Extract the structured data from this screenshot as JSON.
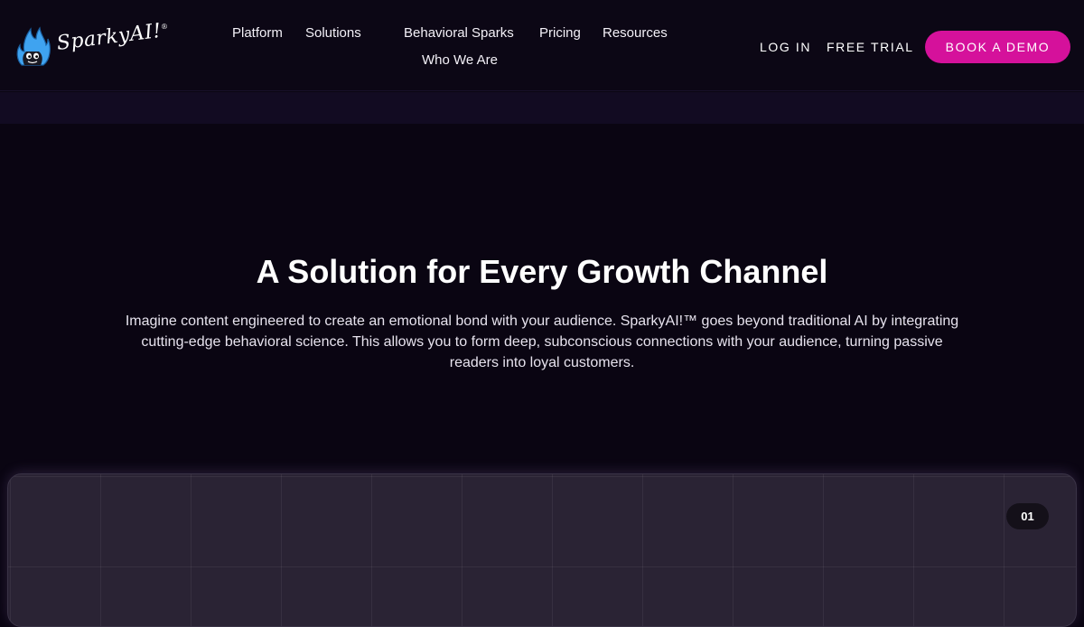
{
  "brand": {
    "name": "SparkyAI!",
    "trademark": "®",
    "logo_icon": "flame-face-icon",
    "colors": {
      "background": "#0a0512",
      "navbar": "#0c0715",
      "accent": "#d5119b",
      "flame": "#3fa3f0",
      "panel": "#2a2334"
    }
  },
  "nav": {
    "links": [
      {
        "label": "Platform"
      },
      {
        "label": "Solutions"
      },
      {
        "label": "Behavioral Sparks"
      },
      {
        "label": "Pricing"
      },
      {
        "label": "Resources"
      },
      {
        "label": "Who We Are"
      }
    ],
    "login": "LOG IN",
    "free_trial": "FREE TRIAL",
    "book_demo": "BOOK A DEMO"
  },
  "hero": {
    "title": "A Solution for Every Growth Channel",
    "description": "Imagine content engineered to create an emotional bond with your audience. SparkyAI!™ goes beyond traditional AI by integrating cutting-edge behavioral science. This allows you to form deep, subconscious connections with your audience, turning passive readers into loyal customers."
  },
  "panel": {
    "step_badge": "01"
  }
}
